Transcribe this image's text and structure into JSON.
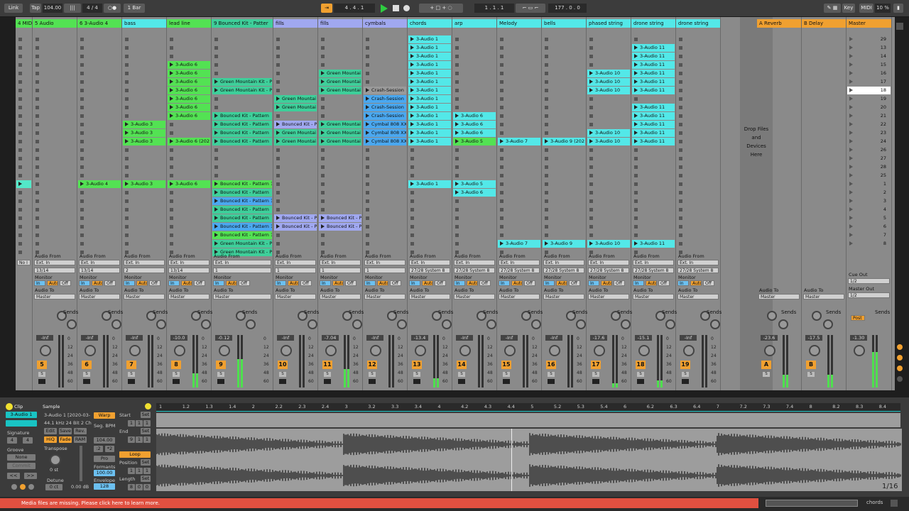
{
  "transport": {
    "link": "Link",
    "tap": "Tap",
    "tempo": "104.00",
    "signature": "4 / 4",
    "quantize": "1 Bar",
    "position": "4 . 4 . 1",
    "loop_start": "1 . 1 . 1",
    "loop_len": "177 . 0 . 0",
    "key": "Key",
    "midi": "MIDI",
    "cpu": "10 %",
    "colors": {
      "accent": "#f0a030",
      "play": "#2ecc40"
    }
  },
  "tracks": [
    {
      "name": "4 MID",
      "color": "#53e253",
      "num": "",
      "clips": [
        {
          "row": 18,
          "label": "",
          "color": "#53e8c8"
        }
      ],
      "route": {
        "from": "",
        "ch": "No I",
        "to": ""
      },
      "vol": ""
    },
    {
      "name": "5 Audio",
      "color": "#53e253",
      "num": "5",
      "clips": [],
      "route": {
        "from": "Audio From",
        "src": "Ext. In",
        "ch": "13/14",
        "to": "Master"
      },
      "vol": "-Inf"
    },
    {
      "name": "6 3-Audio 4",
      "color": "#53e253",
      "num": "6",
      "clips": [
        {
          "row": 18,
          "label": "3-Audio 4",
          "color": "#53e253"
        }
      ],
      "route": {
        "from": "Audio From",
        "src": "Ext. In",
        "ch": "13/14",
        "to": "Master"
      },
      "vol": "-Inf"
    },
    {
      "name": "bass",
      "color": "#53e8e8",
      "num": "7",
      "clips": [
        {
          "row": 11,
          "label": "3-Audio 3",
          "color": "#53e253"
        },
        {
          "row": 12,
          "label": "3-Audio 3",
          "color": "#53e253"
        },
        {
          "row": 13,
          "label": "3-Audio 3",
          "color": "#53e253"
        },
        {
          "row": 18,
          "label": "3-Audio 3",
          "color": "#53e253"
        }
      ],
      "route": {
        "from": "Audio From",
        "src": "Ext. In",
        "ch": "2",
        "to": "Master"
      },
      "vol": "-Inf"
    },
    {
      "name": "lead line",
      "color": "#53e253",
      "num": "8",
      "clips": [
        {
          "row": 4,
          "label": "3-Audio 6",
          "color": "#53e253"
        },
        {
          "row": 5,
          "label": "3-Audio 6",
          "color": "#53e253"
        },
        {
          "row": 6,
          "label": "3-Audio 6",
          "color": "#53e253"
        },
        {
          "row": 7,
          "label": "3-Audio 6",
          "color": "#53e253"
        },
        {
          "row": 8,
          "label": "3-Audio 6",
          "color": "#53e253"
        },
        {
          "row": 9,
          "label": "3-Audio 6",
          "color": "#53e253"
        },
        {
          "row": 10,
          "label": "3-Audio 6",
          "color": "#53e253"
        },
        {
          "row": 13,
          "label": "3-Audio 6 (202",
          "color": "#53e253"
        },
        {
          "row": 18,
          "label": "3-Audio 6",
          "color": "#53e253"
        }
      ],
      "route": {
        "from": "Audio From",
        "src": "Ext. In",
        "ch": "13/14",
        "to": "Master"
      },
      "vol": "-10.0"
    },
    {
      "name": "9 Bounced Kit - Patter",
      "color": "#3ecf9a",
      "num": "9",
      "clips": [
        {
          "row": 6,
          "label": "Green Mountain Kit - P",
          "color": "#3ecf9a"
        },
        {
          "row": 7,
          "label": "Green Mountain Kit - P",
          "color": "#3ecf9a"
        },
        {
          "row": 10,
          "label": "Bounced Kit - Pattern",
          "color": "#3ecf9a"
        },
        {
          "row": 11,
          "label": "Bounced Kit - Pattern",
          "color": "#3ecf9a"
        },
        {
          "row": 12,
          "label": "Bounced Kit - Pattern",
          "color": "#3ecf9a"
        },
        {
          "row": 13,
          "label": "Bounced Kit - Pattern",
          "color": "#3ecf9a"
        },
        {
          "row": 18,
          "label": "Bounced Kit - Pattern 1",
          "color": "#53e253"
        },
        {
          "row": 19,
          "label": "Bounced Kit - Pattern",
          "color": "#3ecf9a"
        },
        {
          "row": 20,
          "label": "Bounced Kit - Pattern 1",
          "color": "#4aa8f0"
        },
        {
          "row": 21,
          "label": "Bounced Kit - Pattern",
          "color": "#3ecf9a"
        },
        {
          "row": 22,
          "label": "Bounced Kit - Pattern",
          "color": "#3ecf9a"
        },
        {
          "row": 23,
          "label": "Bounced Kit - Pattern 1",
          "color": "#4aa8f0"
        },
        {
          "row": 24,
          "label": "Bounced Kit - Pattern 1",
          "color": "#53e253"
        },
        {
          "row": 25,
          "label": "Green Mountain Kit - P",
          "color": "#3ecf9a"
        },
        {
          "row": 26,
          "label": "Green Mountain Kit - P",
          "color": "#3ecf9a"
        }
      ],
      "route": {
        "from": "Audio From",
        "src": "Ext. In",
        "ch": "1",
        "to": "Master"
      },
      "vol": "-0.12"
    },
    {
      "name": "fills",
      "color": "#a0a8f0",
      "num": "10",
      "clips": [
        {
          "row": 8,
          "label": "Green Mountai",
          "color": "#3ecf9a"
        },
        {
          "row": 9,
          "label": "Green Mountai",
          "color": "#3ecf9a"
        },
        {
          "row": 11,
          "label": "Bounced Kit - P",
          "color": "#a0a8f0"
        },
        {
          "row": 12,
          "label": "Green Mountai",
          "color": "#3ecf9a"
        },
        {
          "row": 13,
          "label": "Green Mountai",
          "color": "#3ecf9a"
        },
        {
          "row": 22,
          "label": "Bounced Kit - P",
          "color": "#a0a8f0"
        },
        {
          "row": 23,
          "label": "Bounced Kit - P",
          "color": "#a0a8f0"
        }
      ],
      "route": {
        "from": "Audio From",
        "src": "Ext. In",
        "ch": "1",
        "to": "Master"
      },
      "vol": "-Inf"
    },
    {
      "name": "fills",
      "color": "#a0a8f0",
      "num": "11",
      "clips": [
        {
          "row": 5,
          "label": "Green Mountai",
          "color": "#3ecf9a"
        },
        {
          "row": 6,
          "label": "Green Mountai",
          "color": "#3ecf9a"
        },
        {
          "row": 7,
          "label": "Green Mountai",
          "color": "#3ecf9a"
        },
        {
          "row": 11,
          "label": "Green Mountai",
          "color": "#3ecf9a"
        },
        {
          "row": 12,
          "label": "Green Mountai",
          "color": "#3ecf9a"
        },
        {
          "row": 13,
          "label": "Green Mountai",
          "color": "#3ecf9a"
        },
        {
          "row": 22,
          "label": "Bounced Kit - P",
          "color": "#a0a8f0"
        },
        {
          "row": 23,
          "label": "Bounced Kit - P",
          "color": "#a0a8f0"
        }
      ],
      "route": {
        "from": "Audio From",
        "src": "Ext. In",
        "ch": "1",
        "to": "Master"
      },
      "vol": "-7.04"
    },
    {
      "name": "cymbals",
      "color": "#a0a8f0",
      "num": "12",
      "clips": [
        {
          "row": 7,
          "label": "Crash-Session",
          "color": "#9a9a9a"
        },
        {
          "row": 8,
          "label": "Crash-Session",
          "color": "#4aa8f0"
        },
        {
          "row": 9,
          "label": "Crash-Session",
          "color": "#4aa8f0"
        },
        {
          "row": 10,
          "label": "Crash-Session",
          "color": "#4aa8f0"
        },
        {
          "row": 11,
          "label": "Cymbal 808 XX",
          "color": "#4aa8f0"
        },
        {
          "row": 12,
          "label": "Cymbal 808 XX",
          "color": "#4aa8f0"
        },
        {
          "row": 13,
          "label": "Cymbal 808 XX",
          "color": "#4aa8f0"
        }
      ],
      "route": {
        "from": "Audio From",
        "src": "Ext. In",
        "ch": "1",
        "to": "Master"
      },
      "vol": "-Inf"
    },
    {
      "name": "chords",
      "color": "#53e8e8",
      "num": "13",
      "clips": [
        {
          "row": 1,
          "label": "3-Audio 1",
          "color": "#53e8e8"
        },
        {
          "row": 2,
          "label": "3-Audio 1",
          "color": "#53e8e8"
        },
        {
          "row": 3,
          "label": "3-Audio 1",
          "color": "#53e8e8"
        },
        {
          "row": 4,
          "label": "3-Audio 1",
          "color": "#53e8e8"
        },
        {
          "row": 5,
          "label": "3-Audio 1",
          "color": "#53e8e8"
        },
        {
          "row": 6,
          "label": "3-Audio 1",
          "color": "#53e8e8"
        },
        {
          "row": 7,
          "label": "3-Audio 1",
          "color": "#53e8e8"
        },
        {
          "row": 8,
          "label": "3-Audio 1",
          "color": "#53e8e8"
        },
        {
          "row": 9,
          "label": "3-Audio 1",
          "color": "#53e8e8"
        },
        {
          "row": 10,
          "label": "3-Audio 1",
          "color": "#53e8e8"
        },
        {
          "row": 11,
          "label": "3-Audio 1",
          "color": "#53e8e8"
        },
        {
          "row": 12,
          "label": "3-Audio 1",
          "color": "#53e8e8"
        },
        {
          "row": 13,
          "label": "3-Audio 1",
          "color": "#53e8e8"
        },
        {
          "row": 18,
          "label": "3-Audio 1",
          "color": "#53e8e8"
        }
      ],
      "route": {
        "from": "Audio From",
        "src": "Ext. In",
        "ch": "27/28 System 8",
        "to": "Master"
      },
      "vol": "-13.4"
    },
    {
      "name": "arp",
      "color": "#53e8e8",
      "num": "14",
      "clips": [
        {
          "row": 10,
          "label": "3-Audio 6",
          "color": "#53e8e8"
        },
        {
          "row": 11,
          "label": "3-Audio 6",
          "color": "#53e8e8"
        },
        {
          "row": 12,
          "label": "3-Audio 6",
          "color": "#53e8e8"
        },
        {
          "row": 13,
          "label": "3-Audio 5",
          "color": "#53e253"
        },
        {
          "row": 18,
          "label": "3-Audio 5",
          "color": "#53e8e8"
        },
        {
          "row": 19,
          "label": "3-Audio 6",
          "color": "#53e8e8"
        }
      ],
      "route": {
        "from": "Audio From",
        "src": "Ext. In",
        "ch": "27/28 System 8",
        "to": "Master"
      },
      "vol": "-Inf"
    },
    {
      "name": "Melody",
      "color": "#53e8e8",
      "num": "15",
      "clips": [
        {
          "row": 13,
          "label": "3-Audio 7",
          "color": "#53e8e8"
        },
        {
          "row": 25,
          "label": "3-Audio 7",
          "color": "#53e8e8"
        }
      ],
      "route": {
        "from": "Audio From",
        "src": "Ext. In",
        "ch": "27/28 System 8",
        "to": "Master"
      },
      "vol": "-Inf"
    },
    {
      "name": "bells",
      "color": "#53e8e8",
      "num": "16",
      "clips": [
        {
          "row": 13,
          "label": "3-Audio 9 (202",
          "color": "#53e8e8"
        },
        {
          "row": 25,
          "label": "3-Audio 9",
          "color": "#53e8e8"
        }
      ],
      "route": {
        "from": "Audio From",
        "src": "Ext. In",
        "ch": "27/28 System 8",
        "to": "Master"
      },
      "vol": "-Inf"
    },
    {
      "name": "phased string",
      "color": "#53e8e8",
      "num": "17",
      "clips": [
        {
          "row": 5,
          "label": "3-Audio 10",
          "color": "#53e8e8"
        },
        {
          "row": 6,
          "label": "3-Audio 10",
          "color": "#53e8e8"
        },
        {
          "row": 7,
          "label": "3-Audio 10",
          "color": "#53e8e8"
        },
        {
          "row": 12,
          "label": "3-Audio 10",
          "color": "#53e8e8"
        },
        {
          "row": 13,
          "label": "3-Audio 10",
          "color": "#53e8e8"
        },
        {
          "row": 25,
          "label": "3-Audio 10",
          "color": "#53e8e8"
        }
      ],
      "route": {
        "from": "Audio From",
        "src": "Ext. In",
        "ch": "27/28 System 8",
        "to": "Master"
      },
      "vol": "-17.6"
    },
    {
      "name": "drone string",
      "color": "#53e8e8",
      "num": "18",
      "clips": [
        {
          "row": 2,
          "label": "3-Audio 11",
          "color": "#53e8e8"
        },
        {
          "row": 3,
          "label": "3-Audio 11",
          "color": "#53e8e8"
        },
        {
          "row": 4,
          "label": "3-Audio 11",
          "color": "#53e8e8"
        },
        {
          "row": 5,
          "label": "3-Audio 11",
          "color": "#53e8e8"
        },
        {
          "row": 6,
          "label": "3-Audio 11",
          "color": "#53e8e8"
        },
        {
          "row": 7,
          "label": "3-Audio 11",
          "color": "#53e8e8"
        },
        {
          "row": 9,
          "label": "3-Audio 11",
          "color": "#53e8e8"
        },
        {
          "row": 10,
          "label": "3-Audio 11",
          "color": "#53e8e8"
        },
        {
          "row": 11,
          "label": "3-Audio 11",
          "color": "#53e8e8"
        },
        {
          "row": 12,
          "label": "3-Audio 11",
          "color": "#53e8e8"
        },
        {
          "row": 13,
          "label": "3-Audio 11",
          "color": "#53e8e8"
        },
        {
          "row": 25,
          "label": "3-Audio 11",
          "color": "#53e8e8"
        }
      ],
      "route": {
        "from": "Audio From",
        "src": "Ext. In",
        "ch": "27/28 System 8",
        "to": "Master"
      },
      "vol": "-15.1"
    },
    {
      "name": "drone string",
      "color": "#53e8e8",
      "num": "19",
      "clips": [],
      "route": {
        "from": "Audio From",
        "src": "Ext. In",
        "ch": "27/28 System 8",
        "to": "Master"
      },
      "vol": "-Inf"
    }
  ],
  "returns": [
    {
      "name": "A Reverb",
      "color": "#f0a030",
      "num": "A",
      "vol": "-23.6",
      "to": "Master"
    },
    {
      "name": "B Delay",
      "color": "#f0a030",
      "num": "B",
      "vol": "-17.5",
      "to": "Master"
    }
  ],
  "master": {
    "name": "Master",
    "scenes": [
      "29",
      "13",
      "14",
      "15",
      "16",
      "17",
      "18",
      "19",
      "20",
      "21",
      "22",
      "23",
      "24",
      "26",
      "27",
      "28",
      "25",
      "1",
      "2",
      "3",
      "4",
      "5",
      "6",
      "7",
      "8"
    ],
    "selected_scene": "18",
    "cue_out": "Cue Out",
    "cue_val": "1/2",
    "master_out": "Master Out",
    "master_val": "1/2",
    "vol": "-1.30"
  },
  "dropzone": "Drop Files and Devices Here",
  "labels": {
    "audio_from": "Audio From",
    "monitor": "Monitor",
    "audio_to": "Audio To",
    "sends": "Sends",
    "in": "In",
    "auto": "Auto",
    "off": "Off",
    "s": "S",
    "post": "Post"
  },
  "clip": {
    "tab_clip": "Clip",
    "tab_sample": "Sample",
    "name": "3-Audio 1",
    "file": "3-Audio 1 [2020-03-",
    "info": "44.1 kHz 24 Bit 2 Ch",
    "warp": "Warp",
    "edit": "Edit",
    "save": "Save",
    "rev": "Rev.",
    "hiq": "HiQ",
    "fade": "Fade",
    "ram": "RAM",
    "signature_label": "Signature",
    "sig_num": "4",
    "sig_den": "4",
    "groove_label": "Groove",
    "groove_val": "None",
    "commit": "Commit",
    "seg_bpm_label": "Seg. BPM",
    "seg_bpm": "104.00",
    "half": ":2",
    "double": "*2",
    "mode": "Pro",
    "formants_label": "Formants",
    "formants": "100.00",
    "envelope_label": "Envelope",
    "envelope": "128",
    "transpose_label": "Transpose",
    "transpose": "0 st",
    "detune_label": "Detune",
    "detune": "0 ct",
    "gain": "0.00 dB",
    "start_label": "Start",
    "end_label": "End",
    "loop_label": "Loop",
    "position_label": "Position",
    "length_label": "Length",
    "set": "Set",
    "start_val": [
      "1",
      "1",
      "1"
    ],
    "end_val": [
      "9",
      "1",
      "1"
    ],
    "pos_val": [
      "1",
      "1",
      "1"
    ],
    "len_val": [
      "8",
      "0",
      "0"
    ],
    "ruler": [
      "1",
      "1.2",
      "1.3",
      "1.4",
      "2",
      "2.2",
      "2.3",
      "2.4",
      "3",
      "3.2",
      "3.3",
      "3.4",
      "4",
      "4.2",
      "4.3",
      "4.4",
      "5",
      "5.2",
      "5.3",
      "5.4",
      "6",
      "6.2",
      "6.3",
      "6.4",
      "7",
      "7.2",
      "7.3",
      "7.4",
      "8",
      "8.2",
      "8.3",
      "8.4"
    ],
    "zoom": "1/16"
  },
  "status": {
    "message": "Media files are missing. Please click here to learn more.",
    "track": "chords"
  }
}
